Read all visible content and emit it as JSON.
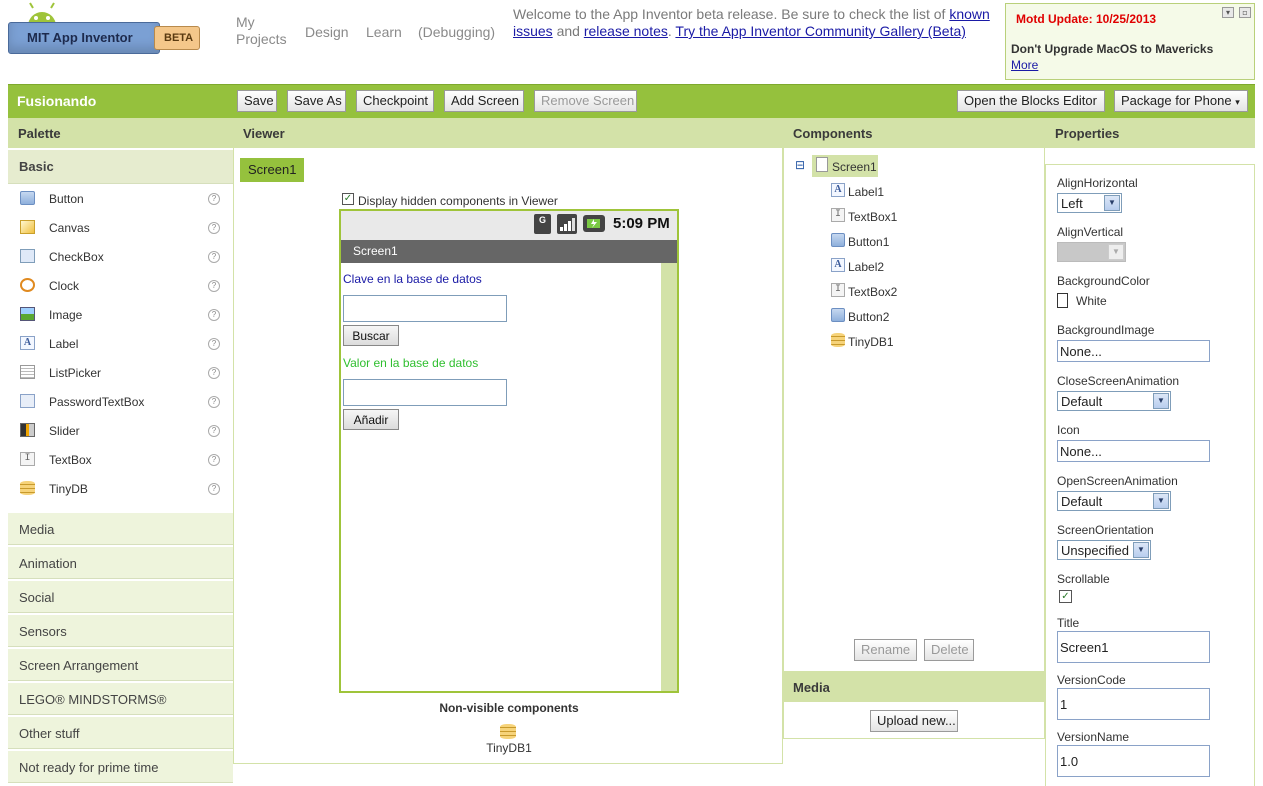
{
  "header": {
    "logo_text": "MIT App Inventor",
    "logo_badge": "BETA",
    "nav": {
      "my_projects": "My Projects",
      "design": "Design",
      "learn": "Learn",
      "debugging": "(Debugging)"
    },
    "welcome": {
      "text1": "Welcome to the App Inventor beta release. Be sure to check the list of",
      "link1": "known issues",
      "text2": "and",
      "link2": "release notes",
      "text3": ".",
      "link3": "Try the App Inventor Community Gallery (Beta)"
    },
    "motd": {
      "title": "Motd Update: 10/25/2013",
      "body": "Don't Upgrade MacOS to Mavericks",
      "more": "More"
    }
  },
  "toolbar": {
    "project_name": "Fusionando",
    "save": "Save",
    "save_as": "Save As",
    "checkpoint": "Checkpoint",
    "add_screen": "Add Screen",
    "remove_screen": "Remove Screen",
    "open_blocks": "Open the Blocks Editor",
    "package": "Package for Phone",
    "package_arrow": "▾"
  },
  "palette": {
    "title": "Palette",
    "basic": "Basic",
    "help_glyph": "?",
    "items": [
      {
        "label": "Button",
        "icon": "button-icon"
      },
      {
        "label": "Canvas",
        "icon": "canvas-icon"
      },
      {
        "label": "CheckBox",
        "icon": "checkbox-icon"
      },
      {
        "label": "Clock",
        "icon": "clock-icon"
      },
      {
        "label": "Image",
        "icon": "image-icon"
      },
      {
        "label": "Label",
        "icon": "label-icon"
      },
      {
        "label": "ListPicker",
        "icon": "listpicker-icon"
      },
      {
        "label": "PasswordTextBox",
        "icon": "password-icon"
      },
      {
        "label": "Slider",
        "icon": "slider-icon"
      },
      {
        "label": "TextBox",
        "icon": "textbox-icon"
      },
      {
        "label": "TinyDB",
        "icon": "database-icon"
      }
    ],
    "categories": [
      "Media",
      "Animation",
      "Social",
      "Sensors",
      "Screen Arrangement",
      "LEGO® MINDSTORMS®",
      "Other stuff",
      "Not ready for prime time"
    ]
  },
  "viewer": {
    "title": "Viewer",
    "screen_tab": "Screen1",
    "display_hidden": "Display hidden components in Viewer",
    "time": "5:09 PM",
    "screen_title": "Screen1",
    "label1": "Clave en la base de datos",
    "button1": "Buscar",
    "label2": "Valor en la base de datos",
    "button2": "Añadir",
    "nonvisible_title": "Non-visible components",
    "nonvisible_item": "TinyDB1",
    "colors": {
      "label1": "#1a1aa6",
      "label2": "#2fbf2f",
      "accent": "#95c13d"
    }
  },
  "components": {
    "title": "Components",
    "collapse": "⊟",
    "tree": {
      "root": "Screen1",
      "children": [
        "Label1",
        "TextBox1",
        "Button1",
        "Label2",
        "TextBox2",
        "Button2",
        "TinyDB1"
      ]
    },
    "rename": "Rename",
    "delete": "Delete",
    "media_title": "Media",
    "upload": "Upload new..."
  },
  "properties": {
    "title": "Properties",
    "align_h_label": "AlignHorizontal",
    "align_h_value": "Left",
    "align_v_label": "AlignVertical",
    "bgcolor_label": "BackgroundColor",
    "bgcolor_value": "White",
    "bgimage_label": "BackgroundImage",
    "bgimage_value": "None...",
    "close_anim_label": "CloseScreenAnimation",
    "close_anim_value": "Default",
    "icon_label": "Icon",
    "icon_value": "None...",
    "open_anim_label": "OpenScreenAnimation",
    "open_anim_value": "Default",
    "orientation_label": "ScreenOrientation",
    "orientation_value": "Unspecified",
    "scrollable_label": "Scrollable",
    "check_glyph": "✓",
    "title_label": "Title",
    "title_value": "Screen1",
    "version_code_label": "VersionCode",
    "version_code_value": "1",
    "version_name_label": "VersionName",
    "version_name_value": "1.0",
    "select_arrow": "▼"
  }
}
